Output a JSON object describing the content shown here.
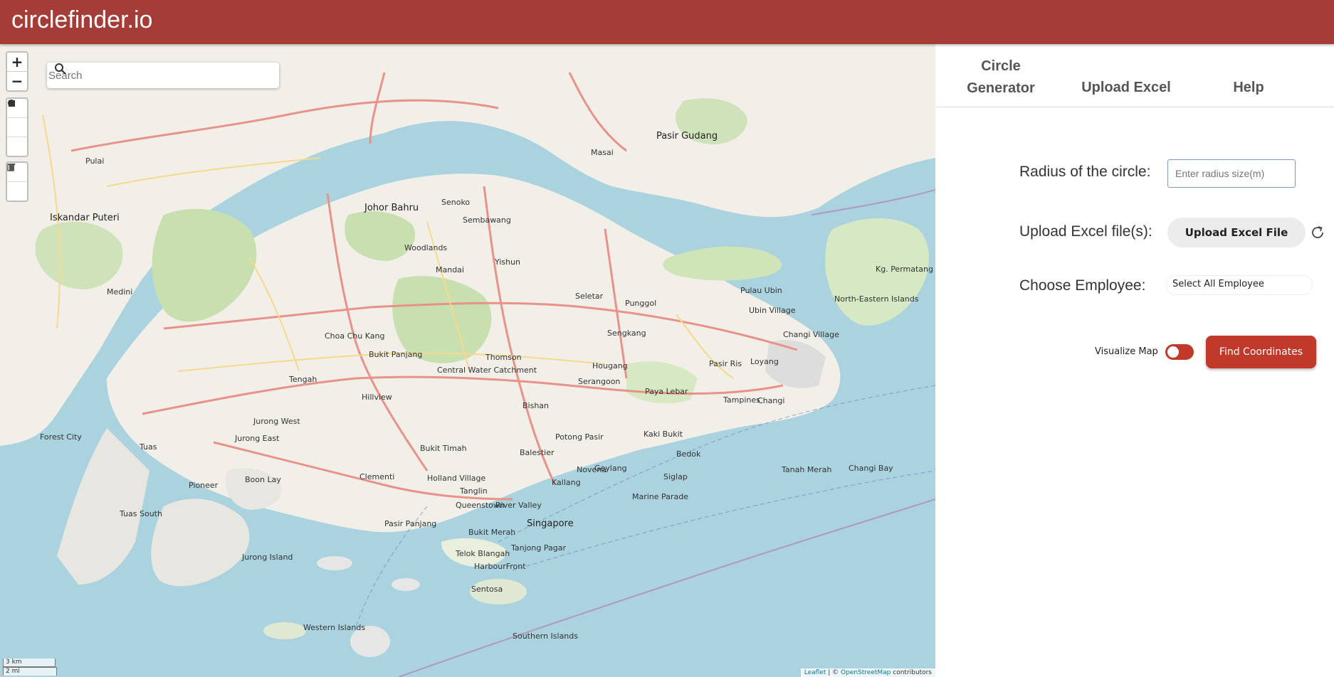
{
  "app": {
    "title": "circlefinder.io"
  },
  "map": {
    "search_placeholder": "Search",
    "zoom_in": "+",
    "zoom_out": "−",
    "scale_km": "3 km",
    "scale_mi": "2 mi",
    "attribution": {
      "leaflet": "Leaflet",
      "sep": " | © ",
      "osm": "OpenStreetMap",
      "tail": " contributors"
    },
    "labels": [
      {
        "text": "Singapore",
        "cls": "lblb"
      },
      {
        "text": "Johor Bahru",
        "cls": "lblb"
      },
      {
        "text": "Iskandar Puteri",
        "cls": "lblb"
      },
      {
        "text": "Pasir Gudang",
        "cls": "lblb"
      },
      {
        "text": "Woodlands"
      },
      {
        "text": "Yishun"
      },
      {
        "text": "Sembawang"
      },
      {
        "text": "Punggol"
      },
      {
        "text": "Sengkang"
      },
      {
        "text": "Seletar"
      },
      {
        "text": "Hougang"
      },
      {
        "text": "Serangoon"
      },
      {
        "text": "Bishan"
      },
      {
        "text": "Tampines"
      },
      {
        "text": "Pasir Ris"
      },
      {
        "text": "Changi"
      },
      {
        "text": "Changi Village"
      },
      {
        "text": "Loyang"
      },
      {
        "text": "Bedok"
      },
      {
        "text": "Geylang"
      },
      {
        "text": "Kallang"
      },
      {
        "text": "Clementi"
      },
      {
        "text": "Jurong West"
      },
      {
        "text": "Jurong East"
      },
      {
        "text": "Pioneer"
      },
      {
        "text": "Tuas"
      },
      {
        "text": "Tuas South"
      },
      {
        "text": "Boon Lay"
      },
      {
        "text": "Queenstown"
      },
      {
        "text": "Bukit Timah"
      },
      {
        "text": "Bukit Panjang"
      },
      {
        "text": "Choa Chu Kang"
      },
      {
        "text": "Tengah"
      },
      {
        "text": "Hillview"
      },
      {
        "text": "Mandai"
      },
      {
        "text": "Central Water Catchment"
      },
      {
        "text": "Thomson"
      },
      {
        "text": "Sentosa"
      },
      {
        "text": "HarbourFront"
      },
      {
        "text": "Telok Blangah"
      },
      {
        "text": "Tanjong Pagar"
      },
      {
        "text": "Bukit Merah"
      },
      {
        "text": "Pasir Panjang"
      },
      {
        "text": "Jurong Island"
      },
      {
        "text": "Western Islands"
      },
      {
        "text": "Southern Islands"
      },
      {
        "text": "Pulau Ubin"
      },
      {
        "text": "Ubin Village"
      },
      {
        "text": "Kg. Permatang"
      },
      {
        "text": "North-Eastern Islands"
      },
      {
        "text": "Pulai"
      },
      {
        "text": "Masai"
      },
      {
        "text": "Senoko"
      },
      {
        "text": "Forest City"
      },
      {
        "text": "Medini"
      },
      {
        "text": "Marine Parade"
      },
      {
        "text": "Siglap"
      },
      {
        "text": "Tanah Merah"
      },
      {
        "text": "Changi Bay"
      },
      {
        "text": "Paya Lebar"
      },
      {
        "text": "Potong Pasir"
      },
      {
        "text": "Kaki Bukit"
      },
      {
        "text": "Balestier"
      },
      {
        "text": "Novena"
      },
      {
        "text": "River Valley"
      },
      {
        "text": "Tanglin"
      },
      {
        "text": "Holland Village"
      }
    ]
  },
  "panel": {
    "tabs": [
      {
        "label_line1": "Circle",
        "label_line2": "Generator"
      },
      {
        "label": "Upload Excel"
      },
      {
        "label": "Help"
      }
    ],
    "radius_label": "Radius of the circle:",
    "radius_placeholder": "Enter radius size(m)",
    "upload_label": "Upload Excel file(s):",
    "upload_button": "Upload Excel File",
    "employee_label": "Choose Employee:",
    "employee_select": "Select All Employee",
    "visualize_label": "Visualize Map",
    "find_button": "Find Coordinates"
  },
  "colors": {
    "header": "#a63c37",
    "accent": "#c0392b",
    "water": "#aad3df",
    "land": "#f2efe9",
    "park": "#c8e0b0"
  }
}
